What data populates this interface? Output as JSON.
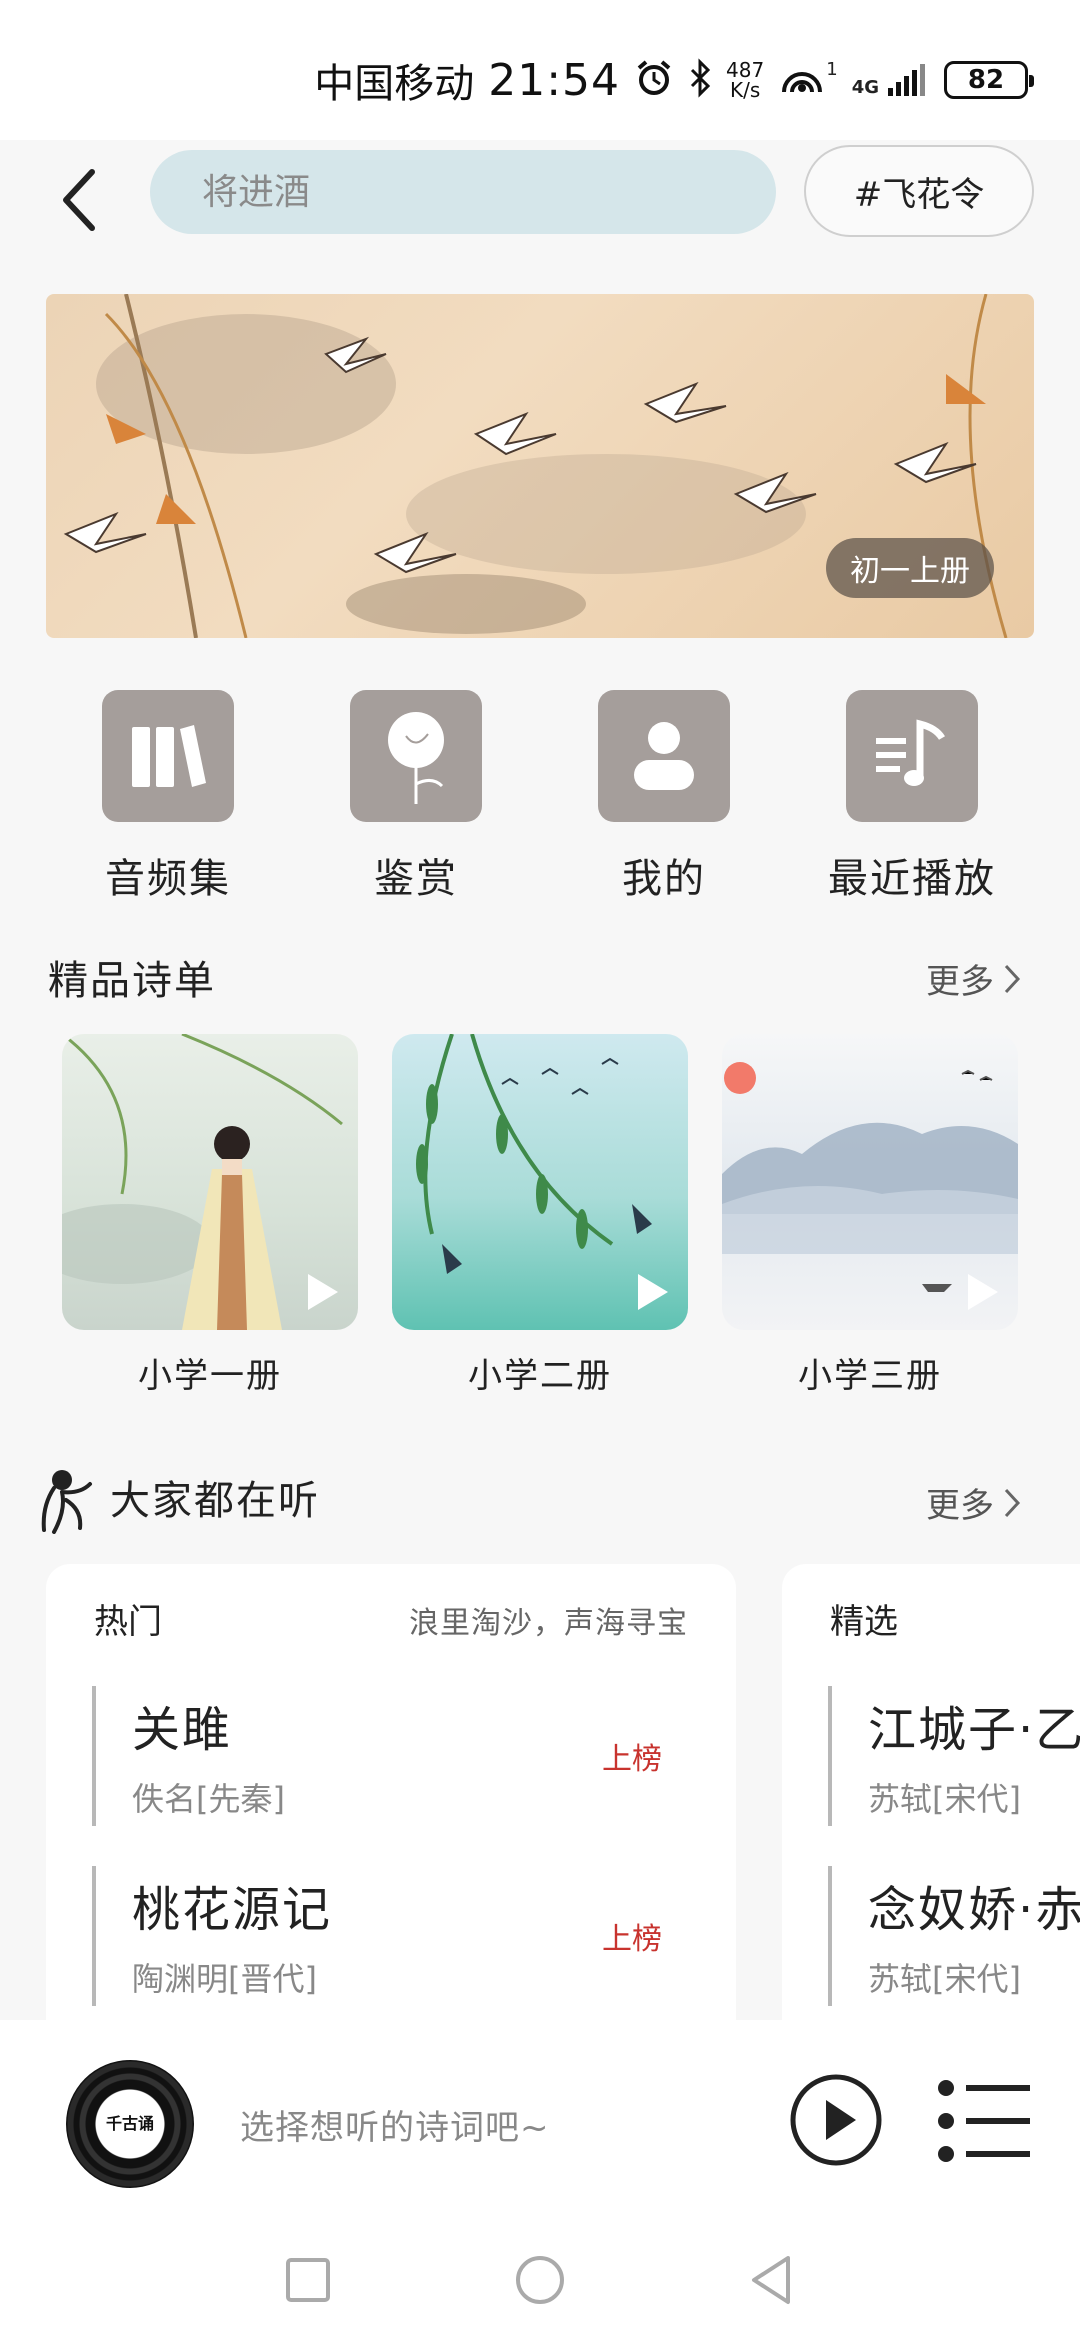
{
  "status_bar": {
    "carrier": "中国移动",
    "time": "21:54",
    "net_speed_value": "487",
    "net_speed_unit": "K/s",
    "hotspot_count": "1",
    "network": "4G",
    "battery": "82"
  },
  "topnav": {
    "search_placeholder": "将进酒",
    "tag_button": "#飞花令"
  },
  "banner": {
    "badge": "初一上册"
  },
  "quick_actions": [
    {
      "label": "音频集",
      "icon": "books-icon"
    },
    {
      "label": "鉴赏",
      "icon": "flower-icon"
    },
    {
      "label": "我的",
      "icon": "user-icon"
    },
    {
      "label": "最近播放",
      "icon": "music-list-icon"
    }
  ],
  "featured": {
    "title": "精品诗单",
    "more": "更多",
    "items": [
      {
        "label": "小学一册"
      },
      {
        "label": "小学二册"
      },
      {
        "label": "小学三册"
      }
    ]
  },
  "listening": {
    "title": "大家都在听",
    "more": "更多",
    "cards": [
      {
        "header": "热门",
        "slogan": "浪里淘沙，声海寻宝",
        "poems": [
          {
            "title": "关雎",
            "author": "佚名[先秦]",
            "tag": "上榜"
          },
          {
            "title": "桃花源记",
            "author": "陶渊明[晋代]",
            "tag": "上榜"
          }
        ]
      },
      {
        "header": "精选",
        "slogan": "",
        "poems": [
          {
            "title": "江城子·乙",
            "author": "苏轼[宋代]",
            "tag": ""
          },
          {
            "title": "念奴娇·赤",
            "author": "苏轼[宋代]",
            "tag": ""
          }
        ]
      }
    ]
  },
  "player": {
    "logo": "千古诵",
    "hint": "选择想听的诗词吧~"
  },
  "colors": {
    "search_bg": "#d5e6ea",
    "icon_tile": "#a59e9b",
    "tag_red": "#c8332e"
  }
}
